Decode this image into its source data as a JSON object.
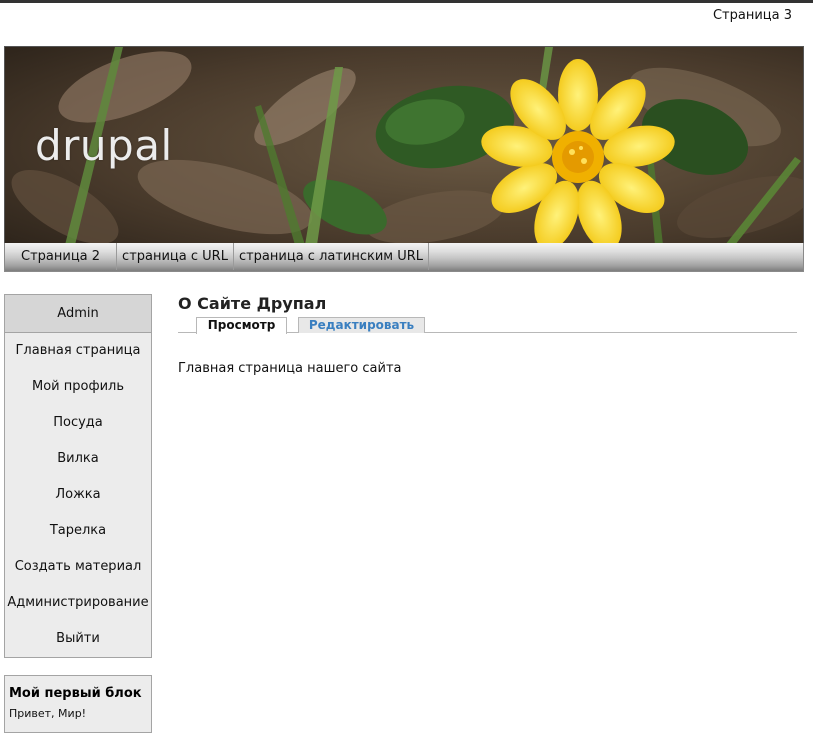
{
  "secondary_links": [
    "Страница 3"
  ],
  "header": {
    "site_name": "drupal"
  },
  "primary_links": [
    "Страница 2",
    "страница с URL",
    "страница с латинским URL"
  ],
  "user_menu": {
    "title": "Admin",
    "items": [
      "Главная страница",
      "Мой профиль",
      "Посуда",
      "Вилка",
      "Ложка",
      "Тарелка",
      "Создать материал",
      "Администрирование",
      "Выйти"
    ]
  },
  "custom_block": {
    "title": "Мой первый блок",
    "body": "Привет, Мир!"
  },
  "content": {
    "title": "О Сайте Друпал",
    "tabs": [
      {
        "label": "Просмотр",
        "active": true
      },
      {
        "label": "Редактировать",
        "active": false
      }
    ],
    "body": "Главная страница нашего сайта"
  },
  "colors": {
    "tab_link": "#3a7fc0",
    "sidebar_bg": "#ececec",
    "header_bg": "#4a3a2c"
  }
}
